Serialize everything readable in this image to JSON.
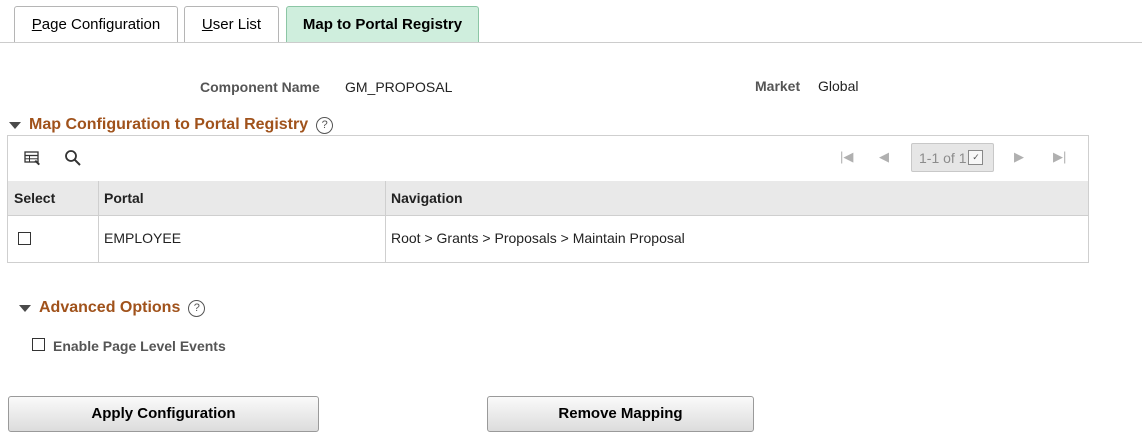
{
  "tabs": [
    {
      "accel": "P",
      "rest": "age Configuration",
      "active": false
    },
    {
      "accel": "U",
      "rest": "ser List",
      "active": false
    },
    {
      "accel": "",
      "rest": "Map to Portal Registry",
      "active": true
    }
  ],
  "header": {
    "component_label": "Component Name",
    "component_value": "GM_PROPOSAL",
    "market_label": "Market",
    "market_value": "Global"
  },
  "map_section": {
    "title": "Map Configuration to Portal Registry",
    "help": "?",
    "pager": "1-1 of 1",
    "columns": [
      "Select",
      "Portal",
      "Navigation"
    ],
    "rows": [
      {
        "selected": false,
        "portal": "EMPLOYEE",
        "navigation": "Root > Grants > Proposals > Maintain Proposal"
      }
    ]
  },
  "advanced": {
    "title": "Advanced Options",
    "help": "?",
    "checkbox_label": "Enable Page Level Events",
    "checked": false
  },
  "buttons": {
    "apply": "Apply Configuration",
    "remove": "Remove Mapping"
  },
  "colors": {
    "section_title": "#a0521b",
    "active_tab": "#cfeedd"
  }
}
